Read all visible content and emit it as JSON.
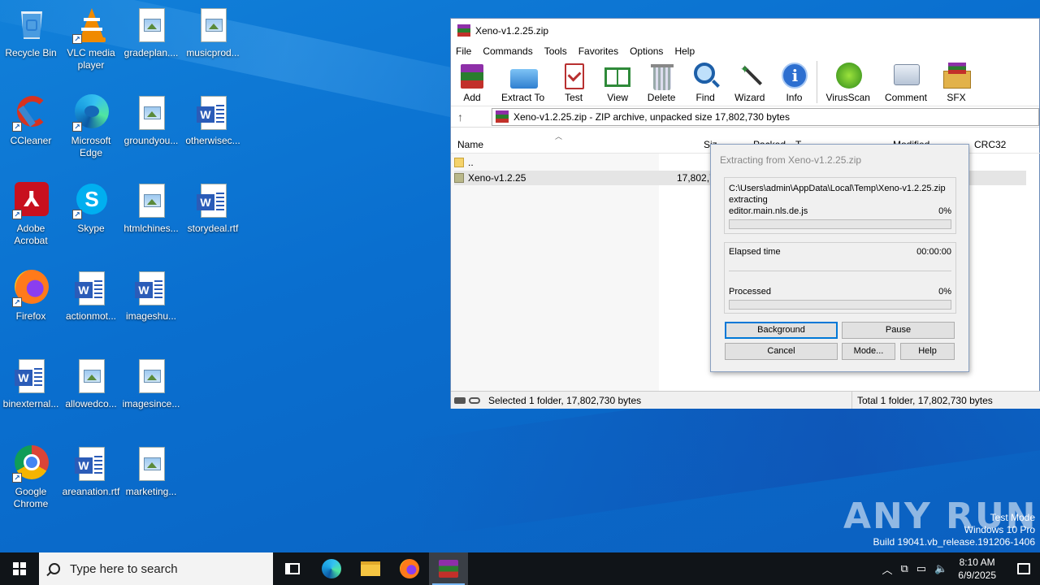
{
  "desktop": {
    "icons": [
      {
        "label": "Recycle Bin",
        "type": "recycle"
      },
      {
        "label": "VLC media player",
        "type": "vlc"
      },
      {
        "label": "gradeplan....",
        "type": "doc"
      },
      {
        "label": "musicprod...",
        "type": "doc"
      },
      {
        "label": "CCleaner",
        "type": "ccleaner"
      },
      {
        "label": "Microsoft Edge",
        "type": "edge"
      },
      {
        "label": "groundyou...",
        "type": "doc"
      },
      {
        "label": "otherwisec...",
        "type": "word"
      },
      {
        "label": "Adobe Acrobat",
        "type": "acrobat"
      },
      {
        "label": "Skype",
        "type": "skype"
      },
      {
        "label": "htmlchines...",
        "type": "doc"
      },
      {
        "label": "storydeal.rtf",
        "type": "word"
      },
      {
        "label": "Firefox",
        "type": "firefox"
      },
      {
        "label": "actionmot...",
        "type": "word"
      },
      {
        "label": "imageshu...",
        "type": "word"
      },
      {
        "label": "binexternal...",
        "type": "word"
      },
      {
        "label": "allowedco...",
        "type": "doc"
      },
      {
        "label": "imagesince...",
        "type": "doc"
      },
      {
        "label": "Google Chrome",
        "type": "chrome"
      },
      {
        "label": "areanation.rtf",
        "type": "word"
      },
      {
        "label": "marketing...",
        "type": "doc"
      }
    ]
  },
  "winrar": {
    "title": "Xeno-v1.2.25.zip",
    "menu": [
      "File",
      "Commands",
      "Tools",
      "Favorites",
      "Options",
      "Help"
    ],
    "toolbar": [
      "Add",
      "Extract To",
      "Test",
      "View",
      "Delete",
      "Find",
      "Wizard",
      "Info",
      "VirusScan",
      "Comment",
      "SFX"
    ],
    "address": "Xeno-v1.2.25.zip - ZIP archive, unpacked size 17,802,730 bytes",
    "columns": {
      "name": "Name",
      "size": "Siz",
      "packed": "Packed",
      "type": "T",
      "modified": "Modified",
      "crc": "CRC32"
    },
    "rows": [
      {
        "name": "..",
        "size": ""
      },
      {
        "name": "Xeno-v1.2.25",
        "size": "17,802,7"
      }
    ],
    "status_left": "Selected 1 folder, 17,802,730 bytes",
    "status_right": "Total 1 folder, 17,802,730 bytes"
  },
  "dialog": {
    "title": "Extracting from Xeno-v1.2.25.zip",
    "path": "C:\\Users\\admin\\AppData\\Local\\Temp\\Xeno-v1.2.25.zip",
    "action": "extracting",
    "file": "editor.main.nls.de.js",
    "file_percent": "0%",
    "file_progress": 0,
    "elapsed_label": "Elapsed time",
    "elapsed_value": "00:00:00",
    "processed_label": "Processed",
    "processed_percent": "0%",
    "processed_progress": 0,
    "buttons": {
      "background": "Background",
      "pause": "Pause",
      "cancel": "Cancel",
      "mode": "Mode...",
      "help": "Help"
    }
  },
  "taskbar": {
    "search_placeholder": "Type here to search",
    "time": "8:10 AM",
    "date": "6/9/2025"
  },
  "watermark": {
    "brand": "ANY RUN",
    "line1": "Test Mode",
    "line2": "Windows 10 Pro",
    "line3": "Build 19041.vb_release.191206-1406"
  }
}
